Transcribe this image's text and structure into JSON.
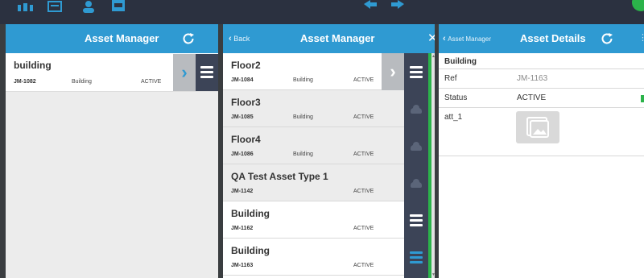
{
  "colors": {
    "header_blue": "#2f9ad2",
    "rail_dark": "#3c4457",
    "active_green": "#2bb34a",
    "topbar": "#2b3140"
  },
  "topbar": {
    "icons": [
      "home-icon",
      "document-icon",
      "user-icon",
      "inbox-icon",
      "arrow-left-icon",
      "arrow-right-icon"
    ]
  },
  "pane1": {
    "title": "Asset Manager",
    "items": [
      {
        "name": "building",
        "ref": "JM-1082",
        "type": "Building",
        "status": "ACTIVE"
      }
    ]
  },
  "pane2": {
    "back_label": "Back",
    "title": "Asset Manager",
    "items": [
      {
        "name": "Floor2",
        "ref": "JM-1084",
        "type": "Building",
        "status": "ACTIVE"
      },
      {
        "name": "Floor3",
        "ref": "JM-1085",
        "type": "Building",
        "status": "ACTIVE"
      },
      {
        "name": "Floor4",
        "ref": "JM-1086",
        "type": "Building",
        "status": "ACTIVE"
      },
      {
        "name": "QA Test Asset Type 1",
        "ref": "JM-1142",
        "type": "",
        "status": "ACTIVE"
      },
      {
        "name": "Building",
        "ref": "JM-1162",
        "type": "",
        "status": "ACTIVE"
      },
      {
        "name": "Building",
        "ref": "JM-1163",
        "type": "",
        "status": "ACTIVE"
      }
    ]
  },
  "pane3": {
    "back_label": "Asset Manager",
    "title": "Asset Details",
    "heading": "Building",
    "fields": [
      {
        "label": "Ref",
        "value": "JM-1163"
      },
      {
        "label": "Status",
        "value": "ACTIVE"
      },
      {
        "label": "att_1",
        "value": ""
      }
    ]
  }
}
